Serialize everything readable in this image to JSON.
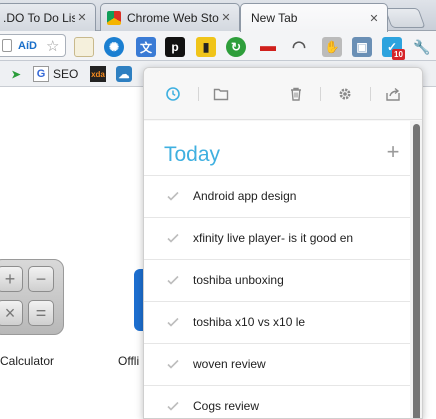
{
  "tabs": [
    {
      "title": ".DO To Do List",
      "active": false
    },
    {
      "title": "Chrome Web Store",
      "active": false
    },
    {
      "title": "New Tab",
      "active": true
    }
  ],
  "omnibox": {
    "fragment": "AíD"
  },
  "toolbar_icons": [
    "clipboard-icon",
    "gear-extension-icon",
    "translate-icon",
    "pocket-icon",
    "phone-icon",
    "refresh-extension-icon",
    "sofa-icon",
    "headphones-icon",
    "hand-icon",
    "image-icon",
    "any-do-icon",
    "wrench-icon"
  ],
  "badge": {
    "count": "10",
    "color": "#d6242a"
  },
  "bookmarks": [
    {
      "label": "",
      "icon": "bird-icon"
    },
    {
      "label": "SEO",
      "icon": "google-icon"
    },
    {
      "label": "",
      "icon": "xda-icon"
    },
    {
      "label": "",
      "icon": "cloud-app-icon"
    }
  ],
  "ntp": {
    "apps": [
      {
        "label": "Calculator"
      },
      {
        "label": "Offli"
      }
    ]
  },
  "popup": {
    "toolbar": [
      "clock-icon",
      "folder-icon",
      "trash-icon",
      "settings-icon",
      "share-icon"
    ],
    "section_title": "Today",
    "add_symbol": "+",
    "accent": "#3fb0e0",
    "tasks": [
      {
        "label": "Android app design"
      },
      {
        "label": "xfinity live player- is it good en"
      },
      {
        "label": "toshiba unboxing"
      },
      {
        "label": "toshiba x10 vs x10 le"
      },
      {
        "label": "woven review"
      },
      {
        "label": "Cogs review"
      }
    ]
  }
}
